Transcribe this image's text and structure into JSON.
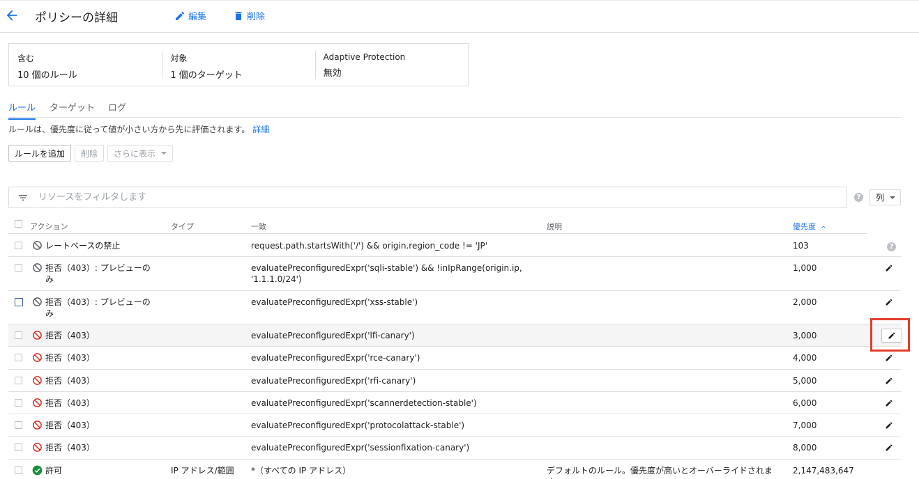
{
  "header": {
    "title": "ポリシーの詳細",
    "edit_label": "編集",
    "delete_label": "削除"
  },
  "summary": [
    {
      "label": "含む",
      "value": "10 個のルール"
    },
    {
      "label": "対象",
      "value": "1 個のターゲット"
    },
    {
      "label": "Adaptive Protection",
      "value": "無効"
    }
  ],
  "tabs": [
    {
      "label": "ルール",
      "active": true
    },
    {
      "label": "ターゲット",
      "active": false
    },
    {
      "label": "ログ",
      "active": false
    }
  ],
  "description": {
    "text": "ルールは、優先度に従って値が小さい方から先に評価されます。",
    "link": "詳細"
  },
  "toolbar": {
    "add_rule": "ルールを追加",
    "delete": "削除",
    "more": "さらに表示"
  },
  "filter": {
    "placeholder": "リソースをフィルタします"
  },
  "columns_button": "列",
  "table": {
    "headers": {
      "action": "アクション",
      "type": "タイプ",
      "match": "一致",
      "description": "説明",
      "priority": "優先度"
    },
    "rows": [
      {
        "action": "レートベースの禁止",
        "action_icon": "ban-gray-icon",
        "type": "",
        "match": "request.path.startsWith('/') && origin.region_code != 'JP'",
        "description": "",
        "priority": "103"
      },
      {
        "action": "拒否（403）: プレビューの\nみ",
        "action_icon": "ban-gray-icon",
        "type": "",
        "match": "evaluatePreconfiguredExpr('sqli-stable') && !inIpRange(origin.ip,\n'1.1.1.0/24')",
        "description": "",
        "priority": "1,000"
      },
      {
        "action": "拒否（403）: プレビューの\nみ",
        "action_icon": "ban-gray-icon",
        "type": "",
        "match": "evaluatePreconfiguredExpr('xss-stable')",
        "description": "",
        "priority": "2,000"
      },
      {
        "action": "拒否（403）",
        "action_icon": "ban-red-icon",
        "type": "",
        "match": "evaluatePreconfiguredExpr('lfi-canary')",
        "description": "",
        "priority": "3,000"
      },
      {
        "action": "拒否（403）",
        "action_icon": "ban-red-icon",
        "type": "",
        "match": "evaluatePreconfiguredExpr('rce-canary')",
        "description": "",
        "priority": "4,000"
      },
      {
        "action": "拒否（403）",
        "action_icon": "ban-red-icon",
        "type": "",
        "match": "evaluatePreconfiguredExpr('rfi-canary')",
        "description": "",
        "priority": "5,000"
      },
      {
        "action": "拒否（403）",
        "action_icon": "ban-red-icon",
        "type": "",
        "match": "evaluatePreconfiguredExpr('scannerdetection-stable')",
        "description": "",
        "priority": "6,000"
      },
      {
        "action": "拒否（403）",
        "action_icon": "ban-red-icon",
        "type": "",
        "match": "evaluatePreconfiguredExpr('protocolattack-stable')",
        "description": "",
        "priority": "7,000"
      },
      {
        "action": "拒否（403）",
        "action_icon": "ban-red-icon",
        "type": "",
        "match": "evaluatePreconfiguredExpr('sessionfixation-canary')",
        "description": "",
        "priority": "8,000"
      },
      {
        "action": "許可",
        "action_icon": "check-circle-green-icon",
        "type": "IP アドレス/範囲",
        "match": "*（すべての IP アドレス）",
        "description": "デフォルトのルール。優先度が高いとオーバーライドされま\nす",
        "priority": "2,147,483,647"
      }
    ]
  },
  "colors": {
    "accent": "#1a73e8",
    "deny_red": "#d93025",
    "allow_green": "#1e8e3e",
    "highlight_red": "#e53d2a"
  }
}
